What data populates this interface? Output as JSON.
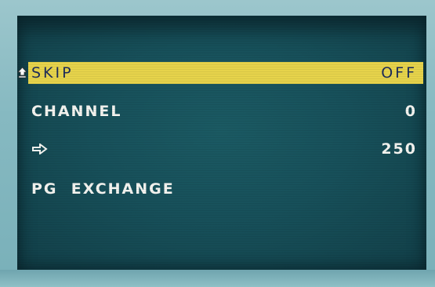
{
  "osd_menu": {
    "items": [
      {
        "label": "SKIP",
        "value": "OFF",
        "selected": true,
        "icon": "upload-cursor-icon"
      },
      {
        "label": "CHANNEL",
        "value": "0",
        "selected": false
      },
      {
        "label": "",
        "value": "250",
        "selected": false,
        "icon": "arrow-right-icon"
      },
      {
        "label": "PG  EXCHANGE",
        "value": "",
        "selected": false
      }
    ]
  },
  "colors": {
    "screen_background": "#17505a",
    "highlight_bar": "#e6d34b",
    "highlight_text": "#1d2c5a",
    "menu_text": "#f4f4f0"
  }
}
